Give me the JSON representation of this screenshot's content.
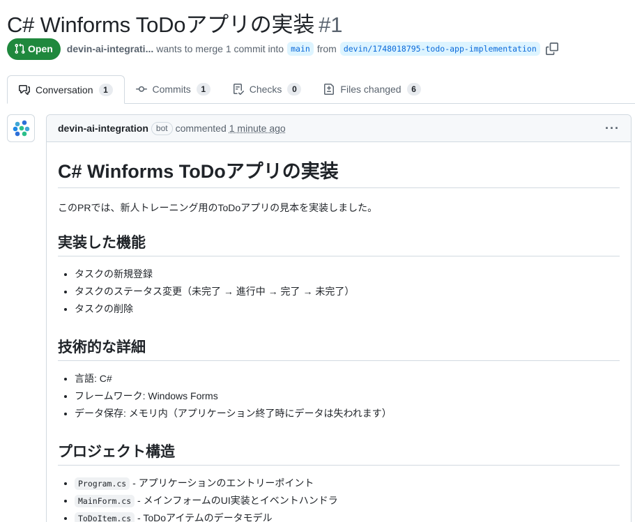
{
  "pr": {
    "title": "C# Winforms ToDoアプリの実装",
    "number": "#1",
    "state": "Open",
    "author": "devin-ai-integrati...",
    "merge_text": "wants to merge 1 commit into",
    "base_branch": "main",
    "from_text": "from",
    "head_branch": "devin/1748018795-todo-app-implementation"
  },
  "tabs": [
    {
      "label": "Conversation",
      "count": "1",
      "icon": "comment-discussion-icon"
    },
    {
      "label": "Commits",
      "count": "1",
      "icon": "commit-icon"
    },
    {
      "label": "Checks",
      "count": "0",
      "icon": "checklist-icon"
    },
    {
      "label": "Files changed",
      "count": "6",
      "icon": "file-diff-icon"
    }
  ],
  "comment": {
    "author": "devin-ai-integration",
    "badge": "bot",
    "action": "commented",
    "time": "1 minute ago",
    "menu": "···"
  },
  "body": {
    "h1": "C# Winforms ToDoアプリの実装",
    "intro": "このPRでは、新人トレーニング用のToDoアプリの見本を実装しました。",
    "sections": [
      {
        "heading": "実装した機能",
        "items": [
          {
            "text": "タスクの新規登録"
          },
          {
            "text": "タスクのステータス変更（未完了 → 進行中 → 完了 → 未完了）"
          },
          {
            "text": "タスクの削除"
          }
        ]
      },
      {
        "heading": "技術的な詳細",
        "items": [
          {
            "text": "言語: C#"
          },
          {
            "text": "フレームワーク: Windows Forms"
          },
          {
            "text": "データ保存: メモリ内（アプリケーション終了時にデータは失われます）"
          }
        ]
      },
      {
        "heading": "プロジェクト構造",
        "items": [
          {
            "code": "Program.cs",
            "text": " - アプリケーションのエントリーポイント"
          },
          {
            "code": "MainForm.cs",
            "text": " - メインフォームのUI実装とイベントハンドラ"
          },
          {
            "code": "ToDoItem.cs",
            "text": " - ToDoアイテムのデータモデル"
          }
        ]
      }
    ]
  },
  "colors": {
    "open_green": "#1f883d",
    "link_blue": "#0969da",
    "branch_bg": "#ddf4ff",
    "border": "#d1d9e0"
  }
}
